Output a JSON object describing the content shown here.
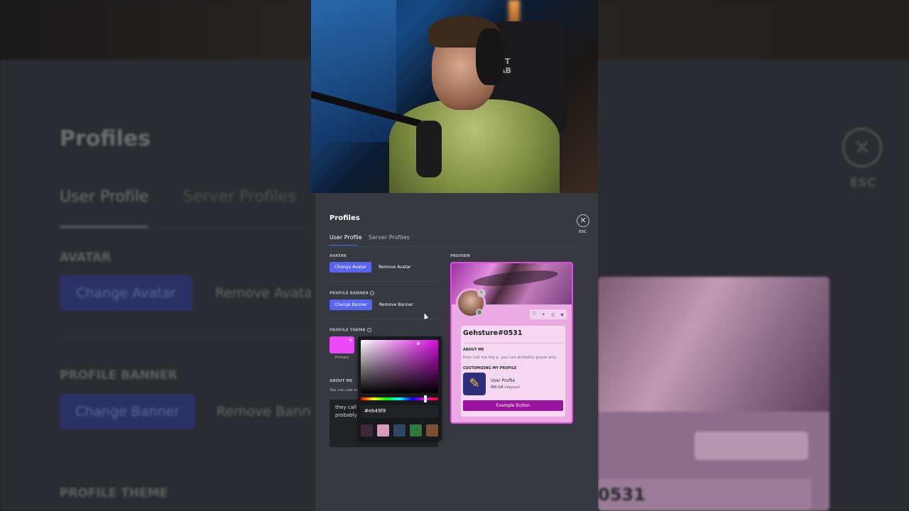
{
  "background": {
    "title": "Profiles",
    "tabs": [
      "User Profile",
      "Server Profiles"
    ],
    "avatar_label": "AVATAR",
    "change_avatar": "Change Avatar",
    "remove_avatar": "Remove Avatar",
    "banner_label": "PROFILE BANNER",
    "change_banner": "Change Banner",
    "remove_banner": "Remove Banner",
    "theme_label": "PROFILE THEME",
    "esc": "ESC",
    "card_name_fragment": "0531"
  },
  "video": {
    "chair_logo": "ST\nAB"
  },
  "modal": {
    "title": "Profiles",
    "esc": "ESC",
    "tabs": {
      "user_profile": "User Profile",
      "server_profiles": "Server Profiles"
    },
    "avatar": {
      "label": "AVATAR",
      "change": "Change Avatar",
      "remove": "Remove Avatar"
    },
    "banner": {
      "label": "PROFILE BANNER",
      "change": "Change Banner",
      "remove": "Remove Banner"
    },
    "theme": {
      "label": "PROFILE THEME",
      "primary": "Primary",
      "primary_color": "#eb49f8"
    },
    "about": {
      "label": "ABOUT ME",
      "hint": "You can use m",
      "text_line1": "they call m",
      "text_line2": "probably"
    },
    "color_picker": {
      "hex_value": "#eb49f8",
      "presets": [
        "#3a2a3a",
        "#d89ab8",
        "#2f4760",
        "#2f7a3a",
        "#7a4f36"
      ]
    },
    "preview": {
      "label": "PREVIEW",
      "username": "Gehsture#0531",
      "about_label": "ABOUT ME",
      "about_text": "they call me big g. you can probably guess why",
      "activity_label": "CUSTOMIZING MY PROFILE",
      "activity_name": "User Profile",
      "elapsed_time": "00:14",
      "elapsed_word": "elapsed",
      "example_button": "Example Button"
    }
  }
}
